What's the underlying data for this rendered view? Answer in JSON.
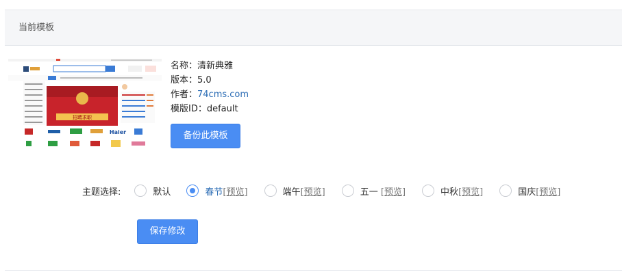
{
  "header": {
    "title": "当前模板"
  },
  "template": {
    "name_label": "名称：清新典雅",
    "version_label": "版本：5.0",
    "author_prefix": "作者：",
    "author_link": "74cms.com",
    "id_label": "模版ID：default",
    "backup_button": "备份此模板"
  },
  "thumbnail": {
    "banner_text": "招聘求职",
    "brand_logos": [
      "Haier"
    ]
  },
  "theme": {
    "label": "主题选择:",
    "selected": "春节",
    "options": [
      {
        "name": "默认",
        "preview": "",
        "checked": false
      },
      {
        "name": "春节",
        "preview": "[预览]",
        "checked": true
      },
      {
        "name": "端午",
        "preview": "[预览]",
        "checked": false
      },
      {
        "name": "五一 ",
        "preview": "[预览]",
        "checked": false
      },
      {
        "name": "中秋",
        "preview": "[预览]",
        "checked": false
      },
      {
        "name": "国庆",
        "preview": "[预览]",
        "checked": false
      }
    ]
  },
  "save_button": "保存修改",
  "colors": {
    "accent": "#4a8df3",
    "link": "#2c6db5",
    "header_bg": "#f5f6f8",
    "border": "#e4e7ec"
  }
}
